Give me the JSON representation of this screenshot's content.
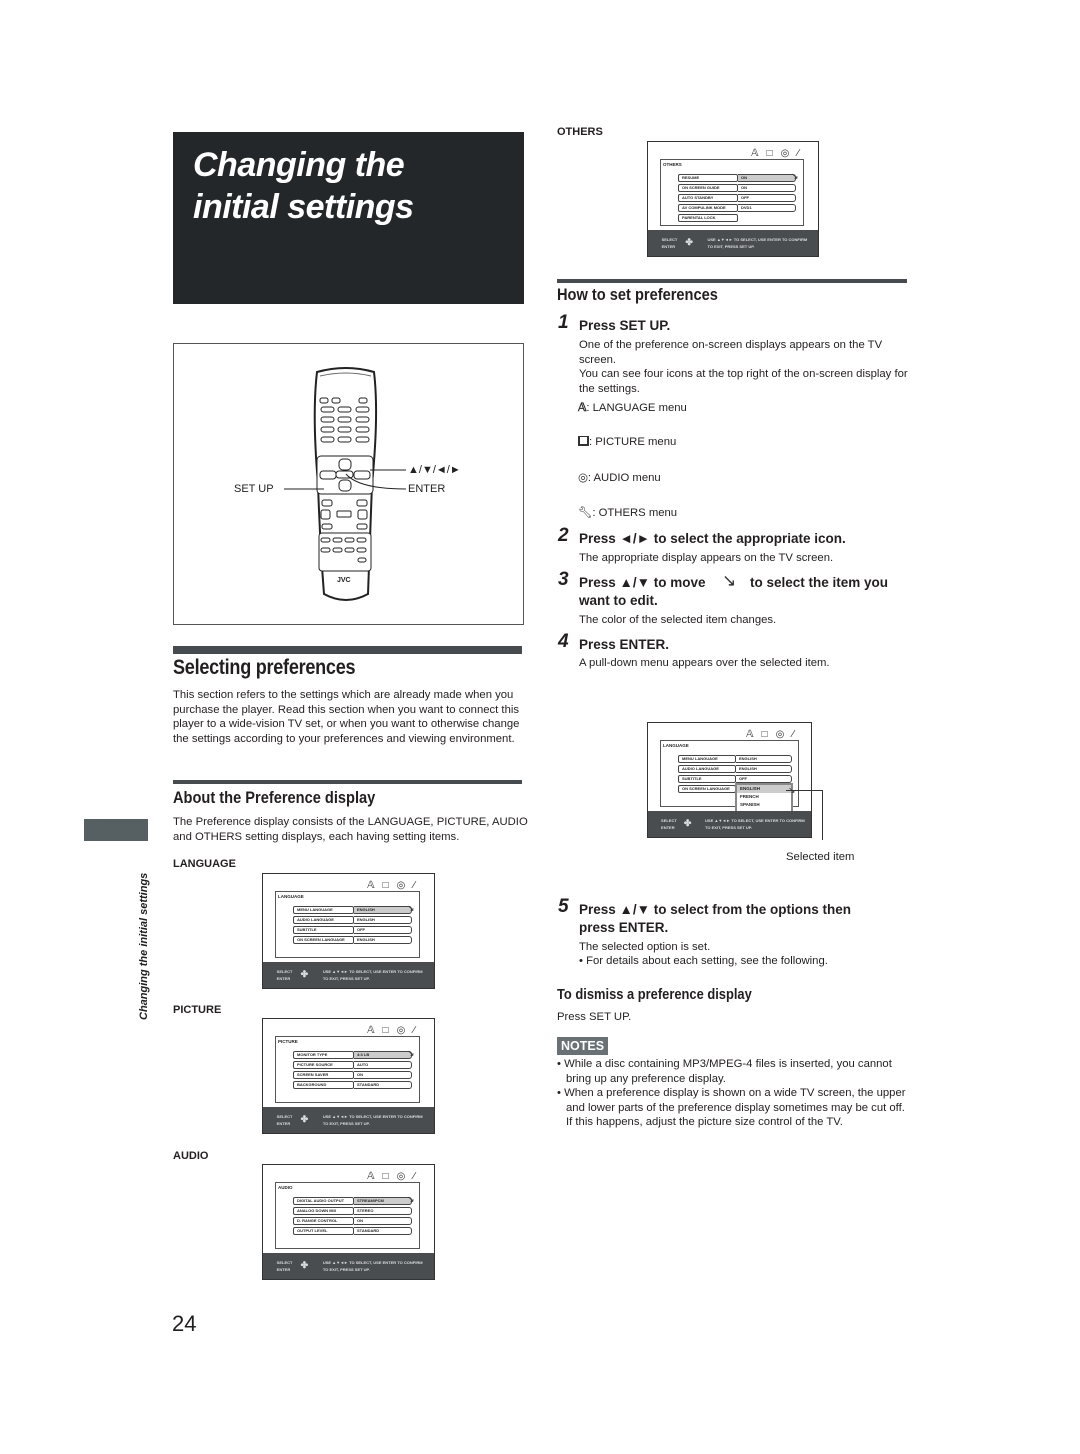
{
  "page": {
    "title": "Changing the initial settings",
    "title_lines": [
      "Changing the",
      "initial settings"
    ],
    "side_label": "Changing the initial settings",
    "page_number": "24"
  },
  "remote": {
    "label_setup": "SET UP",
    "label_arrows": "▲/▼/◄/►",
    "label_enter": "ENTER",
    "brand": "JVC"
  },
  "selecting": {
    "heading": "Selecting preferences",
    "body": "This section refers to the settings which are already made when you purchase the player. Read this section when you want to connect this player to a wide-vision TV set, or when you want to otherwise change the settings according to your preferences and viewing environment."
  },
  "about": {
    "heading": "About the Preference display",
    "body": "The Preference display consists of the LANGUAGE, PICTURE, AUDIO and OTHERS setting displays, each having setting items."
  },
  "osd_common": {
    "footer_left_1": "SELECT",
    "footer_left_2": "ENTER",
    "footer_right_1": "USE ▲▼◄► TO SELECT, USE ENTER TO CONFIRM",
    "footer_right_2": "TO EXIT, PRESS SET UP.",
    "icons": [
      "language-icon",
      "picture-icon",
      "audio-icon",
      "others-icon"
    ]
  },
  "screens": {
    "language": {
      "caption": "LANGUAGE",
      "tab": "LANGUAGE",
      "rows": [
        {
          "key": "MENU LANGUAGE",
          "value": "ENGLISH"
        },
        {
          "key": "AUDIO LANGUAGE",
          "value": "ENGLISH"
        },
        {
          "key": "SUBTITLE",
          "value": "OFF"
        },
        {
          "key": "ON SCREEN LANGUAGE",
          "value": "ENGLISH"
        }
      ]
    },
    "picture": {
      "caption": "PICTURE",
      "tab": "PICTURE",
      "rows": [
        {
          "key": "MONITOR TYPE",
          "value": "4:3 LB"
        },
        {
          "key": "PICTURE SOURCE",
          "value": "AUTO"
        },
        {
          "key": "SCREEN SAVER",
          "value": "ON"
        },
        {
          "key": "BACKGROUND",
          "value": "STANDARD"
        }
      ]
    },
    "audio": {
      "caption": "AUDIO",
      "tab": "AUDIO",
      "rows": [
        {
          "key": "DIGITAL AUDIO OUTPUT",
          "value": "STREAM/PCM"
        },
        {
          "key": "ANALOG DOWN MIX",
          "value": "STEREO"
        },
        {
          "key": "D. RANGE CONTROL",
          "value": "ON"
        },
        {
          "key": "OUTPUT LEVEL",
          "value": "STANDARD"
        }
      ]
    },
    "others": {
      "caption": "OTHERS",
      "tab": "OTHERS",
      "rows": [
        {
          "key": "RESUME",
          "value": "ON"
        },
        {
          "key": "ON SCREEN GUIDE",
          "value": "ON"
        },
        {
          "key": "AUTO STANDBY",
          "value": "OFF"
        },
        {
          "key": "AV COMPULINK MODE",
          "value": "DVD1"
        },
        {
          "key": "PARENTAL LOCK",
          "value": ""
        }
      ]
    },
    "pulldown": {
      "tab": "LANGUAGE",
      "rows": [
        {
          "key": "MENU LANGUAGE",
          "value": "ENGLISH"
        },
        {
          "key": "AUDIO LANGUAGE",
          "value": "ENGLISH"
        },
        {
          "key": "SUBTITLE",
          "value": "OFF"
        },
        {
          "key": "ON SCREEN LANGUAGE",
          "value": ""
        }
      ],
      "options": [
        "ENGLISH",
        "FRENCH",
        "SPANISH"
      ],
      "callout": "Selected item"
    }
  },
  "how_to": {
    "heading": "How to set preferences",
    "steps": [
      {
        "num": "1",
        "title": "Press SET UP.",
        "desc": "One of the preference on-screen displays appears on the TV screen.\nYou can see four icons at the top right of the on-screen display for the settings."
      },
      {
        "num": "2",
        "title": "Press ◄/► to select the appropriate icon.",
        "desc": "The appropriate display appears on the TV screen."
      },
      {
        "num": "3",
        "title_a": "Press ▲/▼ to move",
        "title_b": "to select the item you",
        "title_c": "want to edit.",
        "desc": "The color of the selected item changes."
      },
      {
        "num": "4",
        "title": "Press ENTER.",
        "desc": "A pull-down menu appears over the selected item."
      },
      {
        "num": "5",
        "title_a": "Press ▲/▼ to select from the options then",
        "title_b": "press ENTER.",
        "desc": "The selected option is set.",
        "bullet": "• For details about each setting, see the following."
      }
    ],
    "icon_legend": [
      {
        "icon": "language-icon",
        "label": ": LANGUAGE menu"
      },
      {
        "icon": "picture-icon",
        "label": ": PICTURE menu"
      },
      {
        "icon": "audio-icon",
        "label": ": AUDIO menu"
      },
      {
        "icon": "others-icon",
        "label": ": OTHERS menu"
      }
    ]
  },
  "dismiss": {
    "heading": "To dismiss a preference display",
    "body": "Press SET UP."
  },
  "notes": {
    "badge": "NOTES",
    "items": [
      "While a disc containing MP3/MPEG-4 files is inserted, you cannot bring up any preference display.",
      "When a preference display is shown on a wide TV screen, the upper and lower parts of the preference display sometimes may be cut off. If this happens, adjust the picture size control of the TV."
    ]
  }
}
